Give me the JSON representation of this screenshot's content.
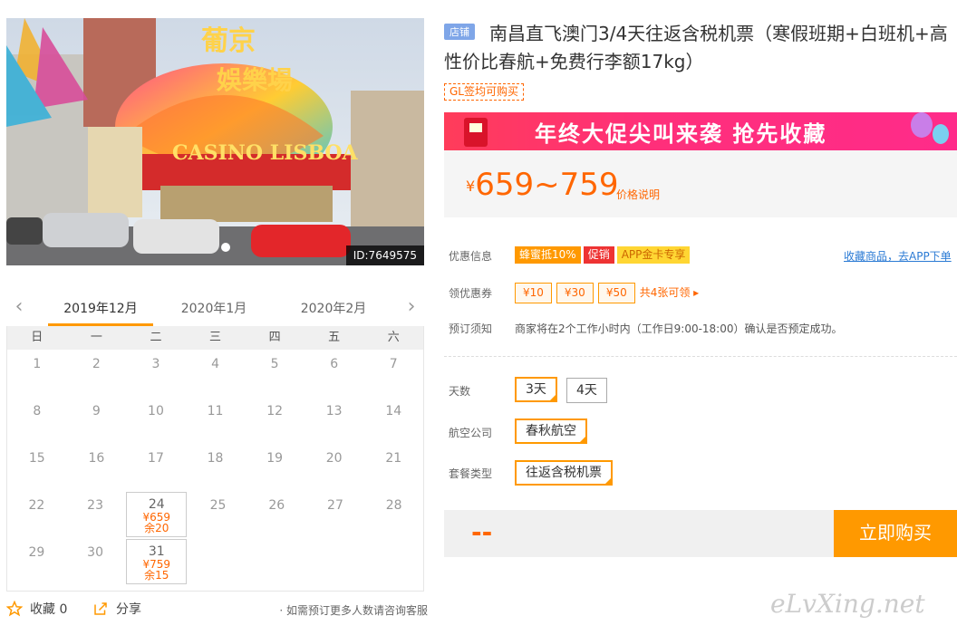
{
  "photo": {
    "id_label": "ID:7649575",
    "sign_top": "葡京",
    "sign_mid": "娛樂場",
    "sign_casino": "CASINO LISBOA"
  },
  "calendar": {
    "months": [
      "2019年12月",
      "2020年1月",
      "2020年2月"
    ],
    "weekdays": [
      "日",
      "一",
      "二",
      "三",
      "四",
      "五",
      "六"
    ],
    "rows": [
      [
        {
          "d": "1"
        },
        {
          "d": "2"
        },
        {
          "d": "3"
        },
        {
          "d": "4"
        },
        {
          "d": "5"
        },
        {
          "d": "6"
        },
        {
          "d": "7"
        }
      ],
      [
        {
          "d": "8"
        },
        {
          "d": "9"
        },
        {
          "d": "10"
        },
        {
          "d": "11"
        },
        {
          "d": "12"
        },
        {
          "d": "13"
        },
        {
          "d": "14"
        }
      ],
      [
        {
          "d": "15"
        },
        {
          "d": "16"
        },
        {
          "d": "17"
        },
        {
          "d": "18"
        },
        {
          "d": "19"
        },
        {
          "d": "20"
        },
        {
          "d": "21"
        }
      ],
      [
        {
          "d": "22"
        },
        {
          "d": "23"
        },
        {
          "d": "24",
          "p": "¥659",
          "s": "余20"
        },
        {
          "d": "25"
        },
        {
          "d": "26"
        },
        {
          "d": "27"
        },
        {
          "d": "28"
        }
      ],
      [
        {
          "d": "29"
        },
        {
          "d": "30"
        },
        {
          "d": "31",
          "p": "¥759",
          "s": "余15"
        },
        {
          "d": ""
        },
        {
          "d": ""
        },
        {
          "d": ""
        },
        {
          "d": ""
        }
      ]
    ]
  },
  "bottom": {
    "fav_label": "收藏 0",
    "share_label": "分享",
    "consult": "· 如需预订更多人数请咨询客服"
  },
  "product": {
    "shop_tag": "店铺",
    "title": "南昌直飞澳门3/4天往返含税机票（寒假班期+白班机+高性价比春航+免费行李额17kg）",
    "gl_tag": "GL签均可购买",
    "banner": "年终大促尖叫来袭  抢先收藏",
    "price_sym": "¥",
    "price_range": "659~759",
    "price_note": "价格说明"
  },
  "info": {
    "promo_label": "优惠信息",
    "promo_badges": [
      "蜂蜜抵10%",
      "促销",
      "APP金卡专享"
    ],
    "fav_link": "收藏商品，去APP下单",
    "coupon_label": "领优惠券",
    "coupons": [
      "¥10",
      "¥30",
      "¥50"
    ],
    "coupon_more": "共4张可领 ▸",
    "notice_label": "预订须知",
    "notice": "商家将在2个工作小时内（工作日9:00-18:00）确认是否预定成功。"
  },
  "options": {
    "days_label": "天数",
    "days": [
      "3天",
      "4天"
    ],
    "airline_label": "航空公司",
    "airline": "春秋航空",
    "package_label": "套餐类型",
    "package": "往返含税机票"
  },
  "buy": {
    "price": "--",
    "button": "立即购买"
  },
  "watermark": "eLvXing.net"
}
